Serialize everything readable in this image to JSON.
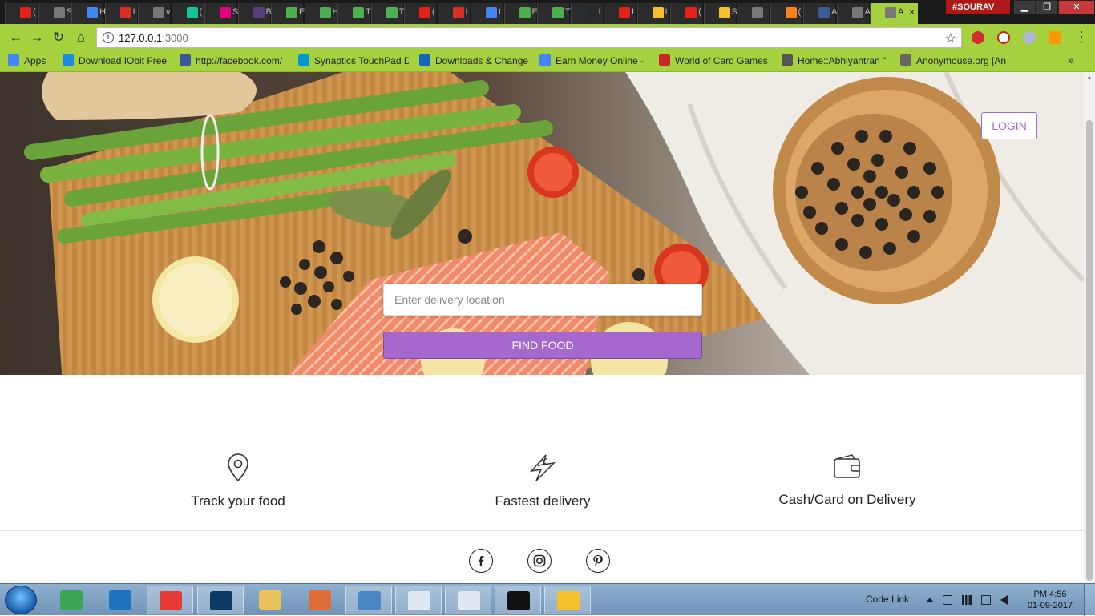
{
  "browser": {
    "tabs": [
      {
        "icon": "youtube-icon",
        "label": "(",
        "color": "#e62117"
      },
      {
        "icon": "page-icon",
        "label": "S",
        "color": "#777777"
      },
      {
        "icon": "google-icon",
        "label": "H",
        "color": "#4285f4"
      },
      {
        "icon": "gmail-icon",
        "label": "I",
        "color": "#d93025"
      },
      {
        "icon": "page-icon",
        "label": "v",
        "color": "#777777"
      },
      {
        "icon": "grammarly-icon",
        "label": "(",
        "color": "#15c39a"
      },
      {
        "icon": "pinterest-icon",
        "label": "S",
        "color": "#e6007e"
      },
      {
        "icon": "bootstrap-icon",
        "label": "B",
        "color": "#563d7c"
      },
      {
        "icon": "w3schools-icon",
        "label": "E",
        "color": "#4caf50"
      },
      {
        "icon": "w3schools-icon",
        "label": "H",
        "color": "#4caf50"
      },
      {
        "icon": "w3schools-icon",
        "label": "T",
        "color": "#4caf50"
      },
      {
        "icon": "w3schools-icon",
        "label": "T",
        "color": "#4caf50"
      },
      {
        "icon": "youtube-icon",
        "label": "(",
        "color": "#e62117"
      },
      {
        "icon": "gmail-icon",
        "label": "I",
        "color": "#d93025"
      },
      {
        "icon": "google-icon",
        "label": "t",
        "color": "#4285f4"
      },
      {
        "icon": "w3schools-icon",
        "label": "E",
        "color": "#4caf50"
      },
      {
        "icon": "w3schools-icon",
        "label": "T",
        "color": "#4caf50"
      },
      {
        "icon": "github-icon",
        "label": "I",
        "color": "#24292e"
      },
      {
        "icon": "youtube-icon",
        "label": "I",
        "color": "#e62117"
      },
      {
        "icon": "emoji-icon",
        "label": "I",
        "color": "#f5c02a"
      },
      {
        "icon": "youtube-icon",
        "label": "(",
        "color": "#e62117"
      },
      {
        "icon": "emoji-icon",
        "label": "S",
        "color": "#f5c02a"
      },
      {
        "icon": "page-icon",
        "label": "I",
        "color": "#777777"
      },
      {
        "icon": "swiggy-icon",
        "label": "(",
        "color": "#fc8019"
      },
      {
        "icon": "facebook-icon",
        "label": "A",
        "color": "#3b5998"
      },
      {
        "icon": "page-icon",
        "label": "A",
        "color": "#777777"
      },
      {
        "icon": "page-icon",
        "label": "A",
        "color": "#777777",
        "active": true
      }
    ],
    "profile_name": "#SOURAV",
    "window_buttons": {
      "minimize": "▁",
      "maximize": "❐",
      "close": "✕"
    },
    "address": {
      "host": "127.0.0.1",
      "port": ":3000"
    },
    "bookmarks": [
      {
        "icon": "apps-icon",
        "label": "Apps",
        "color": "#4285f4"
      },
      {
        "icon": "iobit-icon",
        "label": "Download IObit Free",
        "color": "#1e88e5"
      },
      {
        "icon": "facebook-icon",
        "label": "http://facebook.com/",
        "color": "#3b5998"
      },
      {
        "icon": "hp-icon",
        "label": "Synaptics TouchPad D",
        "color": "#0096d6"
      },
      {
        "icon": "p-icon",
        "label": "Downloads & Change",
        "color": "#1565c0"
      },
      {
        "icon": "google-icon",
        "label": "Earn Money Online -",
        "color": "#4285f4"
      },
      {
        "icon": "cards-icon",
        "label": "World of Card Games",
        "color": "#c62828"
      },
      {
        "icon": "lightbulb-icon",
        "label": "Home::Abhiyantran \"",
        "color": "#555555"
      },
      {
        "icon": "mouse-icon",
        "label": "Anonymouse.org [An",
        "color": "#666666"
      }
    ],
    "bookmarks_more": "»"
  },
  "page": {
    "login_label": "LOGIN",
    "search": {
      "placeholder": "Enter delivery location",
      "value": ""
    },
    "find_label": "FIND FOOD",
    "features": [
      {
        "icon": "location-pin-icon",
        "label": "Track your food"
      },
      {
        "icon": "lightning-icon",
        "label": "Fastest delivery"
      },
      {
        "icon": "wallet-icon",
        "label": "Cash/Card on Delivery"
      }
    ],
    "social": [
      "facebook-icon",
      "instagram-icon",
      "pinterest-icon"
    ],
    "accent_color": "#a468cf"
  },
  "taskbar": {
    "apps": [
      {
        "icon": "rocket-icon",
        "color": "#3aa655",
        "open": false
      },
      {
        "icon": "vscode-icon",
        "color": "#1e73be",
        "open": false
      },
      {
        "icon": "chrome-icon",
        "color": "#e53935",
        "open": true
      },
      {
        "icon": "photoshop-icon",
        "color": "#0b3a66",
        "open": true
      },
      {
        "icon": "folder-icon",
        "color": "#e8c25a",
        "open": false
      },
      {
        "icon": "git-icon",
        "color": "#e06c3a",
        "open": false
      },
      {
        "icon": "photo-viewer-icon",
        "color": "#4a86c5",
        "open": true
      },
      {
        "icon": "window-icon",
        "color": "#dfe8f0",
        "open": true
      },
      {
        "icon": "window-icon",
        "color": "#dfe8f0",
        "open": true
      },
      {
        "icon": "cmd-icon",
        "color": "#111111",
        "open": true
      },
      {
        "icon": "emoji-icon",
        "color": "#f5c02a",
        "open": true
      }
    ],
    "code_link": "Code Link",
    "time": "PM 4:56",
    "date": "01-09-2017"
  }
}
